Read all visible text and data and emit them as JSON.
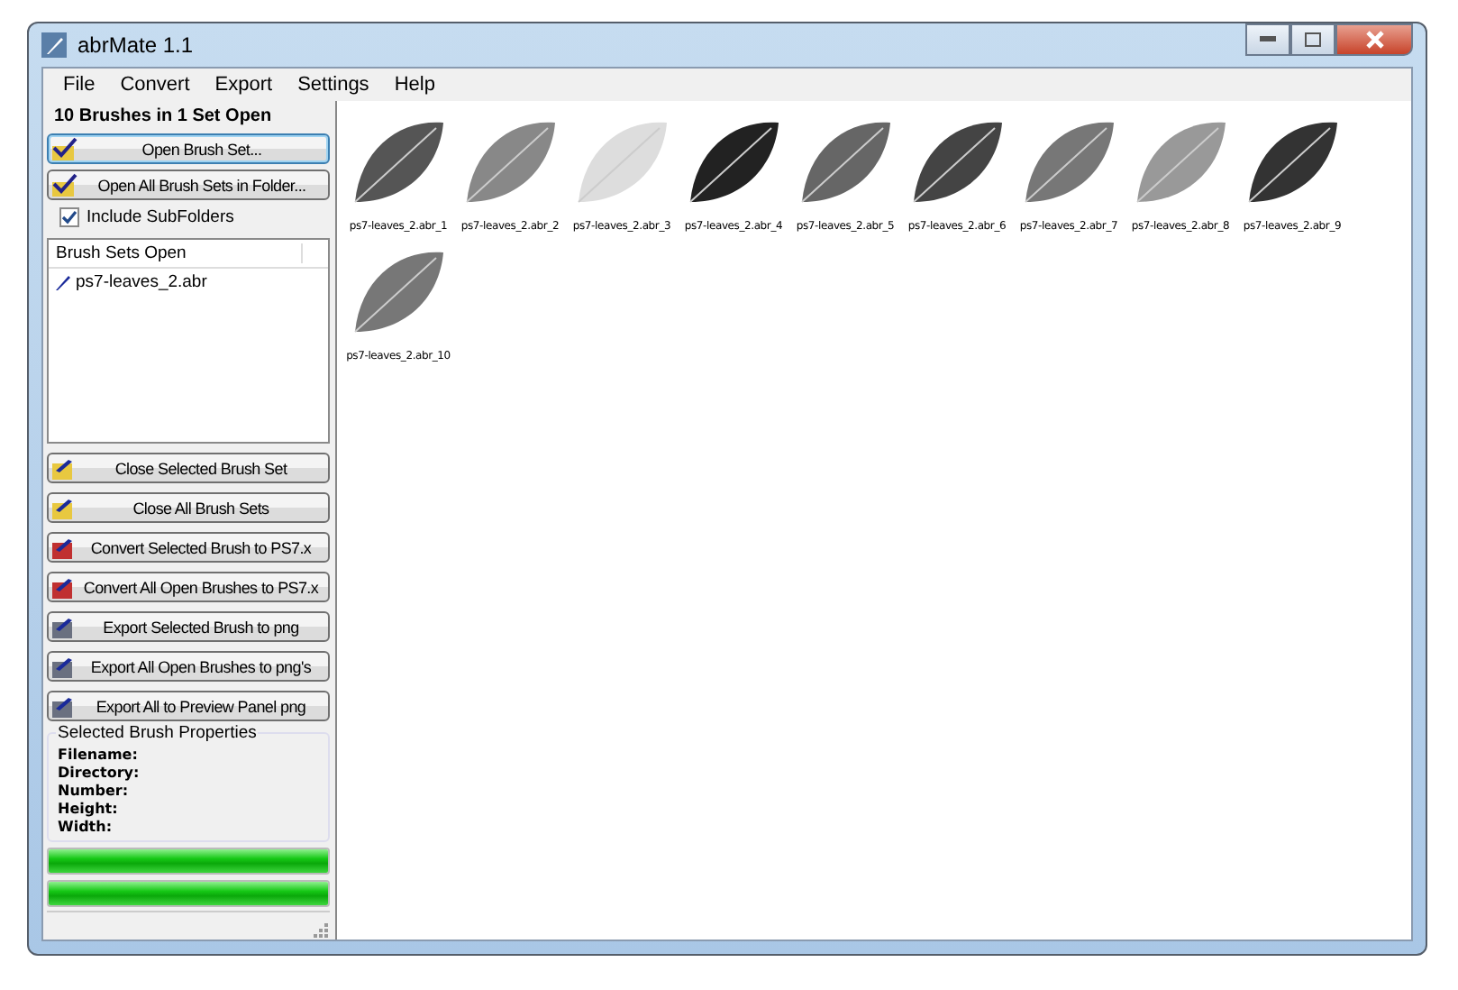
{
  "window": {
    "title": "abrMate 1.1"
  },
  "menu": [
    "File",
    "Convert",
    "Export",
    "Settings",
    "Help"
  ],
  "left": {
    "heading": "10 Brushes in 1 Set Open",
    "top_buttons": [
      {
        "label": "Open Brush Set...",
        "focused": true
      },
      {
        "label": "Open All Brush Sets in Folder...",
        "focused": false
      }
    ],
    "include_subfolders": {
      "label": "Include SubFolders",
      "checked": true
    },
    "list": {
      "header": "Brush Sets Open",
      "items": [
        {
          "label": "ps7-leaves_2.abr",
          "selected": false
        }
      ]
    },
    "buttons": [
      "Close Selected Brush Set",
      "Close All Brush Sets",
      "Convert Selected Brush to PS7.x",
      "Convert All Open Brushes to PS7.x",
      "Export Selected Brush to png",
      "Export All Open Brushes to png's",
      "Export All to Preview Panel png"
    ],
    "properties": {
      "title": "Selected Brush Properties",
      "fields": [
        "Filename:",
        "Directory:",
        "Number:",
        "Height:",
        "Width:"
      ]
    },
    "progress": [
      {
        "level": 1
      },
      {
        "level": 1
      }
    ]
  },
  "brushes": [
    {
      "label": "ps7-leaves_2.abr_1"
    },
    {
      "label": "ps7-leaves_2.abr_2"
    },
    {
      "label": "ps7-leaves_2.abr_3"
    },
    {
      "label": "ps7-leaves_2.abr_4"
    },
    {
      "label": "ps7-leaves_2.abr_5"
    },
    {
      "label": "ps7-leaves_2.abr_6"
    },
    {
      "label": "ps7-leaves_2.abr_7"
    },
    {
      "label": "ps7-leaves_2.abr_8"
    },
    {
      "label": "ps7-leaves_2.abr_9"
    },
    {
      "label": "ps7-leaves_2.abr_10"
    }
  ]
}
